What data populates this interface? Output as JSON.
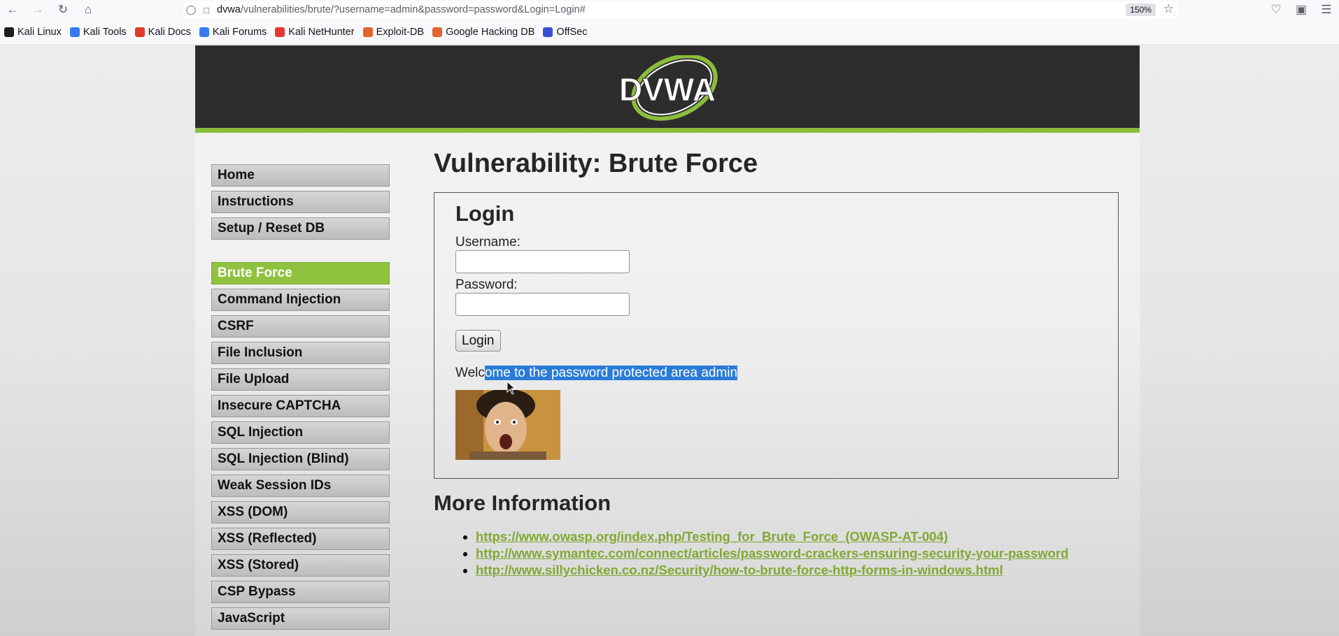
{
  "browser": {
    "url_host": "dvwa",
    "url_path": "/vulnerabilities/brute/?username=admin&password=password&Login=Login#",
    "zoom": "150%"
  },
  "bookmarks": [
    {
      "label": "Kali Linux",
      "color": "#1e1e1e"
    },
    {
      "label": "Kali Tools",
      "color": "#367bf0"
    },
    {
      "label": "Kali Docs",
      "color": "#e23b2e"
    },
    {
      "label": "Kali Forums",
      "color": "#367bf0"
    },
    {
      "label": "Kali NetHunter",
      "color": "#e23b2e"
    },
    {
      "label": "Exploit-DB",
      "color": "#e2642e"
    },
    {
      "label": "Google Hacking DB",
      "color": "#e2642e"
    },
    {
      "label": "OffSec",
      "color": "#3a4fd8"
    }
  ],
  "site": {
    "logo_text": "DVWA"
  },
  "menu": {
    "group1": [
      "Home",
      "Instructions",
      "Setup / Reset DB"
    ],
    "group2": [
      "Brute Force",
      "Command Injection",
      "CSRF",
      "File Inclusion",
      "File Upload",
      "Insecure CAPTCHA",
      "SQL Injection",
      "SQL Injection (Blind)",
      "Weak Session IDs",
      "XSS (DOM)",
      "XSS (Reflected)",
      "XSS (Stored)",
      "CSP Bypass",
      "JavaScript"
    ],
    "selected": "Brute Force"
  },
  "main": {
    "title": "Vulnerability: Brute Force",
    "login_title": "Login",
    "username_label": "Username:",
    "username_value": "",
    "password_label": "Password:",
    "password_value": "",
    "login_button": "Login",
    "welcome_plain": "Welc",
    "welcome_selected": "ome to the password protected area admin",
    "more_info_title": "More Information",
    "links": [
      "https://www.owasp.org/index.php/Testing_for_Brute_Force_(OWASP-AT-004)",
      "http://www.symantec.com/connect/articles/password-crackers-ensuring-security-your-password",
      "http://www.sillychicken.co.nz/Security/how-to-brute-force-http-forms-in-windows.html"
    ]
  },
  "colors": {
    "accent_green": "#8bbd3c",
    "selection_blue": "#2a7bd8",
    "header_dark": "#2d2d2d",
    "link_green": "#81a833"
  }
}
